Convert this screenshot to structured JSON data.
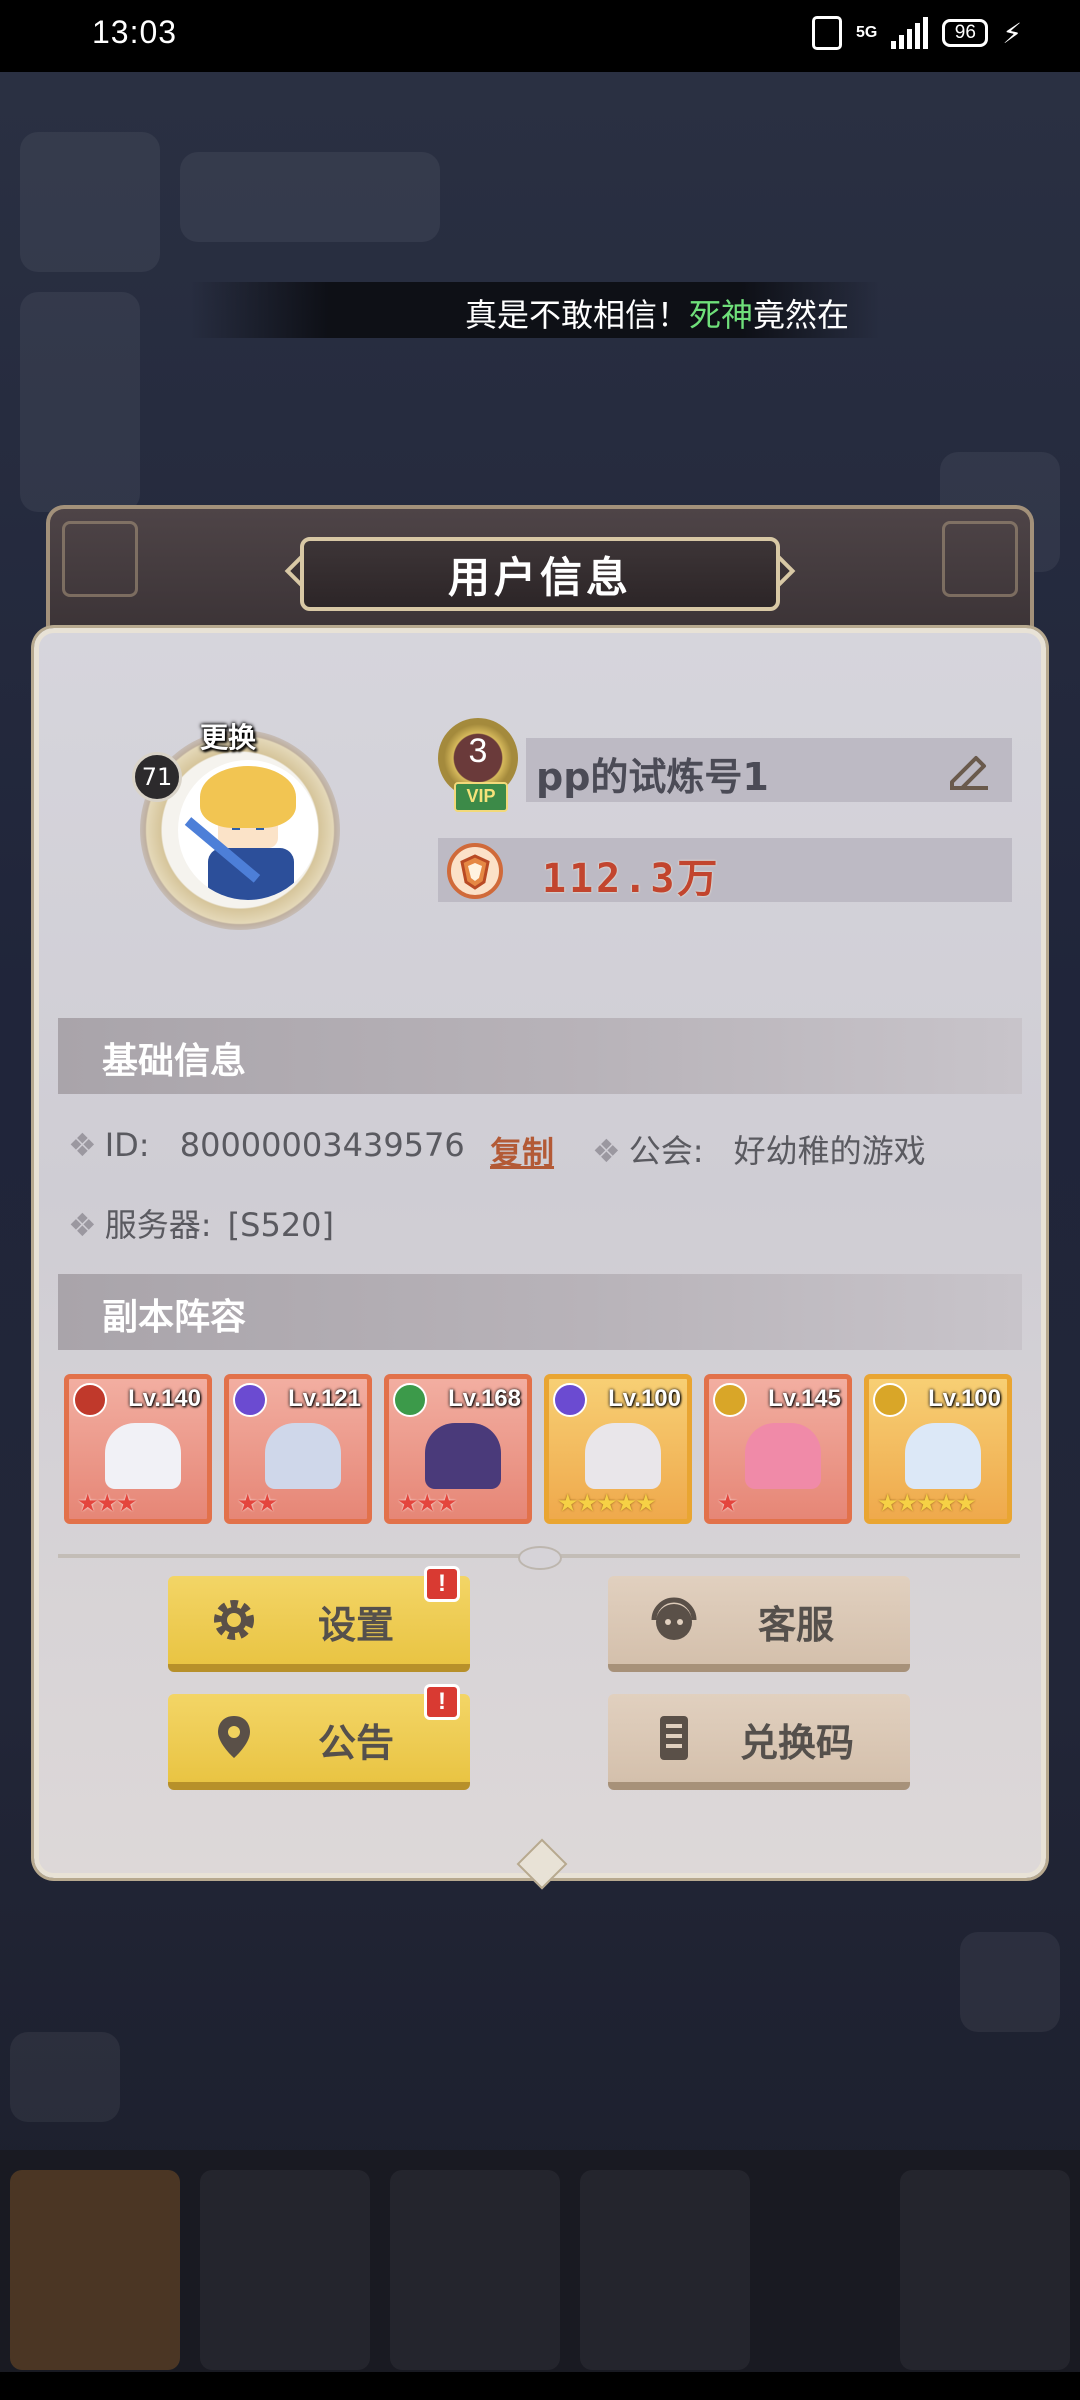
{
  "status_bar": {
    "time": "13:03",
    "network": "5G",
    "battery": "96"
  },
  "marquee": {
    "text_before": "真是不敢相信！",
    "highlight": "死神",
    "text_after": "竟然在"
  },
  "dialog": {
    "title": "用户信息",
    "avatar": {
      "swap_label": "更换",
      "level": "71"
    },
    "vip_level": "3",
    "vip_tag": "VIP",
    "player_name": "pp的试炼号1",
    "power": "112.3万"
  },
  "basic_info": {
    "section_title": "基础信息",
    "id_label": "ID:",
    "id_value": "80000003439576",
    "copy_label": "复制",
    "guild_label": "公会:",
    "guild_value": "好幼稚的游戏",
    "server_label": "服务器:",
    "server_value": "[S520]"
  },
  "lineup": {
    "section_title": "副本阵容",
    "heroes": [
      {
        "level": "Lv.140",
        "stars": "★★★",
        "frame": "red",
        "element": "#c0392b"
      },
      {
        "level": "Lv.121",
        "stars": "★★",
        "frame": "red",
        "element": "#6b4bd1"
      },
      {
        "level": "Lv.168",
        "stars": "★★★",
        "frame": "red",
        "element": "#3c9a4a"
      },
      {
        "level": "Lv.100",
        "stars": "★★★★★",
        "frame": "gold",
        "element": "#6b4bd1"
      },
      {
        "level": "Lv.145",
        "stars": "★",
        "frame": "red",
        "element": "#d9a628"
      },
      {
        "level": "Lv.100",
        "stars": "★★★★★",
        "frame": "gold",
        "element": "#d9a628"
      }
    ]
  },
  "buttons": {
    "settings": "设置",
    "support": "客服",
    "notice": "公告",
    "redeem": "兑换码",
    "alert_mark": "!"
  },
  "colors": {
    "accent_yellow": "#e9c443",
    "accent_beige": "#d4c0ac",
    "power_red": "#c2452e",
    "marquee_highlight": "#6fe07a"
  }
}
